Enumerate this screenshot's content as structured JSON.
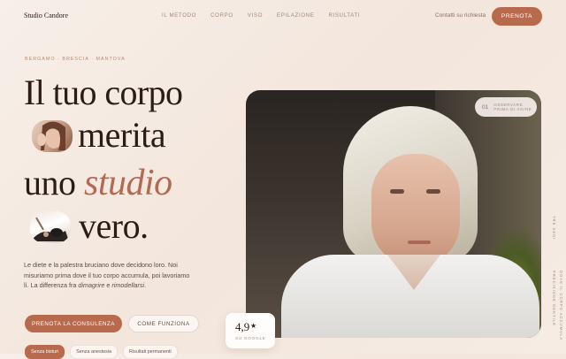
{
  "header": {
    "brand": "Studio Candore",
    "menu": [
      "IL METODO",
      "CORPO",
      "VISO",
      "EPILAZIONE",
      "RISULTATI"
    ],
    "contact_link": "Contatti su richiesta",
    "cta": "PRENOTA"
  },
  "hero": {
    "cities": "BERGAMO · BRESCIA · MANTOVA",
    "line1": "Il tuo corpo",
    "line2": "merita",
    "line3_a": "uno",
    "line3_b": "studio",
    "line4": "vero.",
    "para_a": "Le diete e la palestra bruciano dove decidono loro. Noi misuriamo prima dove il tuo corpo accumula, poi lavoriamo lì. La differenza fra",
    "para_em1": "dimagrire",
    "para_b": "e",
    "para_em2": "rimodellarsi",
    "para_c": ".",
    "primary_button": "PRENOTA LA CONSULENZA",
    "secondary_button": "COME FUNZIONA",
    "chips": [
      "Senza bisturi",
      "Senza anestesia",
      "Risultati permanenti"
    ]
  },
  "photo_badge": {
    "number": "01",
    "text": "OSSERVARE PRIMA DI AGIRE"
  },
  "rating": {
    "score": "4,9",
    "star": "★",
    "source": "SU GOOGLE"
  },
  "side_text": {
    "vertical1": "TRE SEDI",
    "vertical2": "PRECISIONE GENTILE",
    "vertical3": "DOVE IL CORPO ACCUMULA"
  },
  "colors": {
    "accent": "#b86a4c",
    "background": "#f5ebe3",
    "headline": "#2b1d16",
    "italic_accent": "#b26b52"
  }
}
